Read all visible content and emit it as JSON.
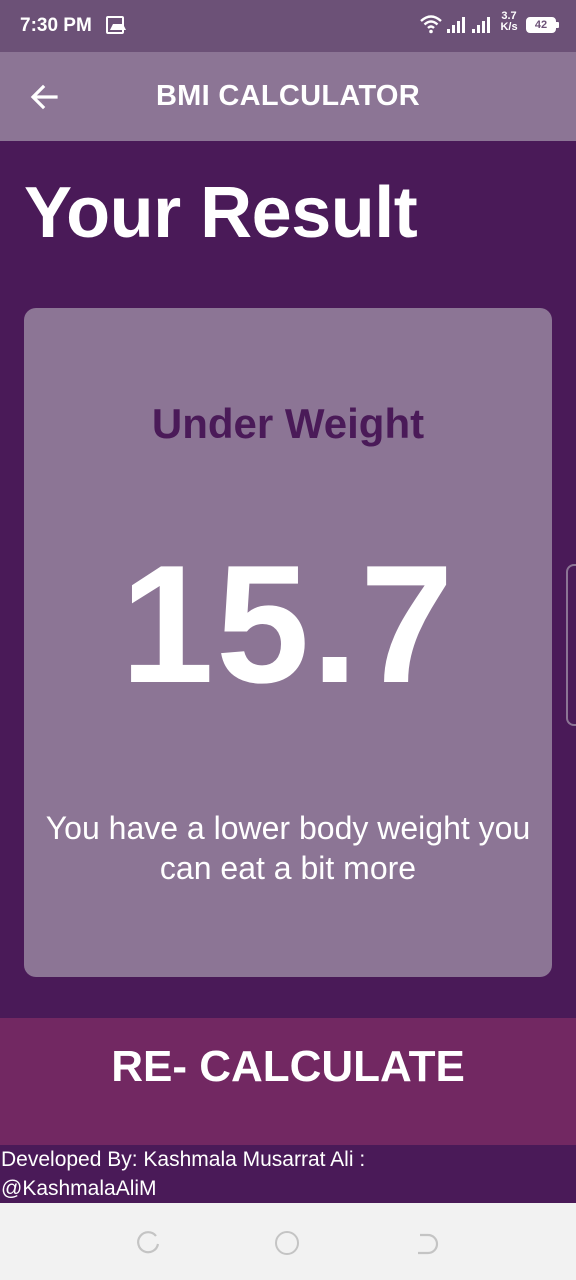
{
  "status_bar": {
    "time": "7:30 PM",
    "net_speed_value": "3.7",
    "net_speed_unit": "K/s",
    "battery": "42"
  },
  "app_bar": {
    "title": "BMI CALCULATOR"
  },
  "main": {
    "heading": "Your Result",
    "result_card": {
      "category": "Under Weight",
      "bmi_value": "15.7",
      "advice": "You have a lower body weight you can eat a bit more"
    },
    "recalculate_label": "RE- CALCULATE"
  },
  "footer": {
    "line1": "Developed By: Kashmala Musarrat Ali :",
    "line2": "@KashmalaAliM"
  },
  "colors": {
    "background": "#4a1a58",
    "card": "#8c7595",
    "button": "#722862",
    "category_text": "#4a1a58"
  }
}
